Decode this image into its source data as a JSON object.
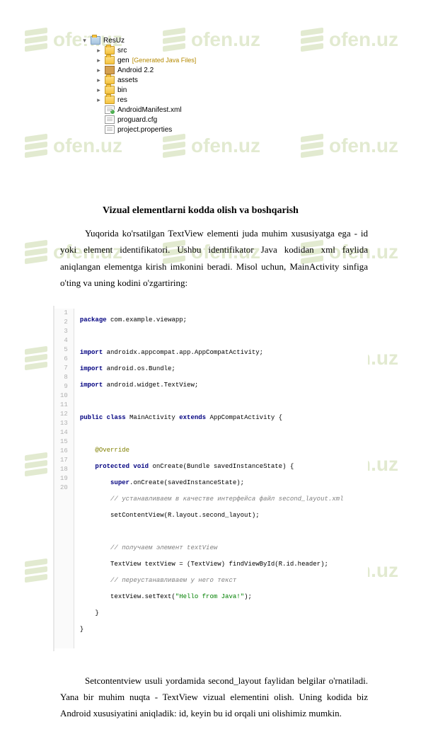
{
  "watermark": "ofen.uz",
  "tree": {
    "root": "ResUz",
    "items": [
      {
        "label": "src",
        "type": "folder"
      },
      {
        "label": "gen",
        "type": "folder",
        "suffix": "[Generated Java Files]"
      },
      {
        "label": "Android 2.2",
        "type": "lib"
      },
      {
        "label": "assets",
        "type": "folder"
      },
      {
        "label": "bin",
        "type": "folder"
      },
      {
        "label": "res",
        "type": "folder"
      },
      {
        "label": "AndroidManifest.xml",
        "type": "file-green"
      },
      {
        "label": "proguard.cfg",
        "type": "file"
      },
      {
        "label": "project.properties",
        "type": "file"
      }
    ]
  },
  "heading1": "Vizual elementlarni kodda olish va boshqarish",
  "para1": "Yuqorida ko'rsatilgan TextView elementi juda muhim xususiyatga ega - id yoki element identifikatori. Ushbu identifikator Java kodidan xml faylida aniqlangan elementga kirish imkonini beradi. Misol uchun, MainActivity sinfiga o'ting va uning kodini o'zgartiring:",
  "code": {
    "l1": "package com.example.viewapp;",
    "l2": "",
    "l3": "import androidx.appcompat.app.AppCompatActivity;",
    "l4": "import android.os.Bundle;",
    "l5": "import android.widget.TextView;",
    "l6": "",
    "l7": "public class MainActivity extends AppCompatActivity {",
    "l8": "",
    "l9": "    @Override",
    "l10": "    protected void onCreate(Bundle savedInstanceState) {",
    "l11": "        super.onCreate(savedInstanceState);",
    "l12a": "        // устанавливаем в качестве интерфейса файл second_layout.xml",
    "l13": "        setContentView(R.layout.second_layout);",
    "l14": "        ",
    "l15a": "        // получаем элемент textView",
    "l16": "        TextView textView = (TextView) findViewById(R.id.header);",
    "l17a": "        // переустанавливаем у него текст",
    "l18": "        textView.setText(\"Hello from Java!\");",
    "l19": "    }",
    "l20": "}"
  },
  "para2": "Setcontentview usuli yordamida  second_layout faylidan belgilar o'rnatiladi.   Yana bir muhim nuqta - TextView vizual elementini olish. Uning kodida biz Android xususiyatini aniqladik: id, keyin bu id orqali uni olishimiz mumkin."
}
